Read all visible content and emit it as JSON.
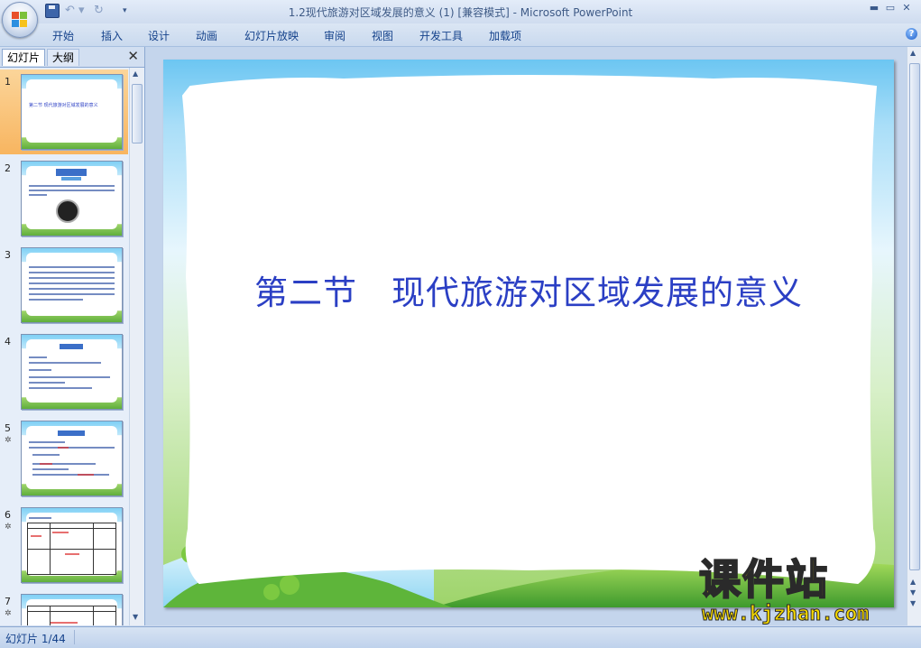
{
  "window": {
    "title_doc": "1.2现代旅游对区域发展的意义 (1) [兼容模式]",
    "title_sep": " - ",
    "title_app": "Microsoft PowerPoint",
    "min_label": "▬",
    "max_label": "▭",
    "close_label": "✕"
  },
  "qat": {
    "undo": "↶ ▾",
    "redo": "↻",
    "more": "▾"
  },
  "ribbon": {
    "tabs": [
      "开始",
      "插入",
      "设计",
      "动画",
      "幻灯片放映",
      "审阅",
      "视图",
      "开发工具",
      "加载项"
    ],
    "help": "?"
  },
  "left_pane": {
    "tab_slides": "幻灯片",
    "tab_outline": "大纲",
    "close": "✕",
    "slide_numbers": [
      "1",
      "2",
      "3",
      "4",
      "5",
      "6",
      "7"
    ],
    "selected_index": 0,
    "thumb1_text": "第二节 现代旅游对区域发展的意义"
  },
  "slide": {
    "title": "第二节　现代旅游对区域发展的意义"
  },
  "watermark": {
    "cn": "课件站",
    "url": "www.kjzhan.com"
  },
  "status": {
    "slide_counter": "幻灯片 1/44"
  },
  "colors": {
    "title_blue": "#2b3fc4",
    "selected_thumb": "#f8b560",
    "watermark_yellow": "#f5d800"
  }
}
